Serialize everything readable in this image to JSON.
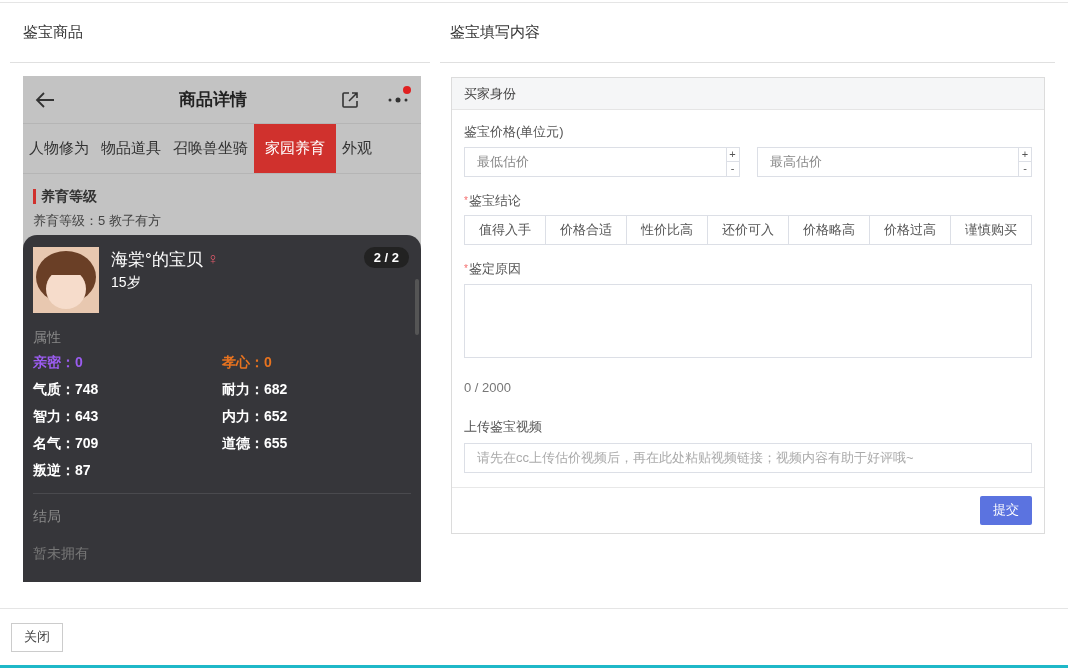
{
  "left_panel": {
    "title": "鉴宝商品"
  },
  "phone": {
    "title": "商品详情",
    "notification_dot": true,
    "tabs": [
      {
        "label": "人物修为",
        "selected": false
      },
      {
        "label": "物品道具",
        "selected": false
      },
      {
        "label": "召唤兽坐骑",
        "selected": false
      },
      {
        "label": "家园养育",
        "selected": true
      },
      {
        "label": "外观",
        "selected": false
      }
    ],
    "section_title": "养育等级",
    "section_text": "养育等级：5  教子有方",
    "child_card": {
      "name": "海棠°的宝贝",
      "gender_icon": "♀",
      "age": "15岁",
      "pager": "2 / 2",
      "attributes_title": "属性",
      "stats": [
        {
          "label": "亲密：0",
          "color": "#9b5cf0"
        },
        {
          "label": "孝心：0",
          "color": "#e8731f"
        },
        {
          "label": "气质：748",
          "color": "#ffffff"
        },
        {
          "label": "耐力：682",
          "color": "#ffffff"
        },
        {
          "label": "智力：643",
          "color": "#ffffff"
        },
        {
          "label": "内力：652",
          "color": "#ffffff"
        },
        {
          "label": "名气：709",
          "color": "#ffffff"
        },
        {
          "label": "道德：655",
          "color": "#ffffff"
        },
        {
          "label": "叛逆：87",
          "color": "#ffffff"
        }
      ],
      "ending_title": "结局",
      "ending_text": "暂未拥有"
    }
  },
  "right_panel": {
    "title": "鉴宝填写内容"
  },
  "form": {
    "header": "买家身份",
    "price_label": "鉴宝价格(单位元)",
    "price_fields": [
      {
        "placeholder": "最低估价",
        "plus": "+",
        "minus": "-"
      },
      {
        "placeholder": "最高估价",
        "plus": "+",
        "minus": "-"
      }
    ],
    "conclusion_label": "鉴宝结论",
    "conclusion_required_mark": "*",
    "conclusions": [
      {
        "label": "值得入手",
        "selected": false
      },
      {
        "label": "价格合适",
        "selected": false
      },
      {
        "label": "性价比高",
        "selected": false
      },
      {
        "label": "还价可入",
        "selected": false
      },
      {
        "label": "价格略高",
        "selected": false
      },
      {
        "label": "价格过高",
        "selected": false
      },
      {
        "label": "谨慎购买",
        "selected": false
      }
    ],
    "reason_label": "鉴定原因",
    "reason_required_mark": "*",
    "counter": "0 / 2000",
    "video_label": "上传鉴宝视频",
    "video_placeholder": "请先在cc上传估价视频后，再在此处粘贴视频链接；视频内容有助于好评哦~",
    "submit": "提交"
  },
  "footer": {
    "close": "关闭"
  }
}
